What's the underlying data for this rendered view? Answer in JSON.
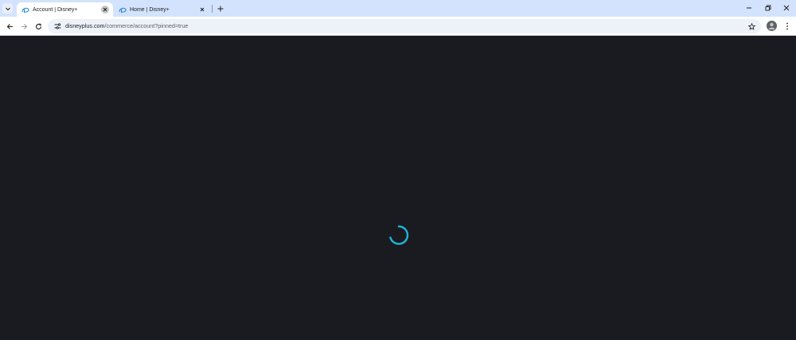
{
  "browser": {
    "tabs": [
      {
        "title": "Account | Disney+",
        "active": true
      },
      {
        "title": "Home | Disney+",
        "active": false
      }
    ],
    "url": {
      "host": "disneyplus.com",
      "path": "/commerce/account?pinned=true"
    },
    "accent_color": "#1f80e0",
    "tabstrip_color": "#d3e3fd"
  },
  "page": {
    "state": "loading",
    "background_color": "#1a1b20",
    "spinner_color": "#1fb5d9"
  }
}
